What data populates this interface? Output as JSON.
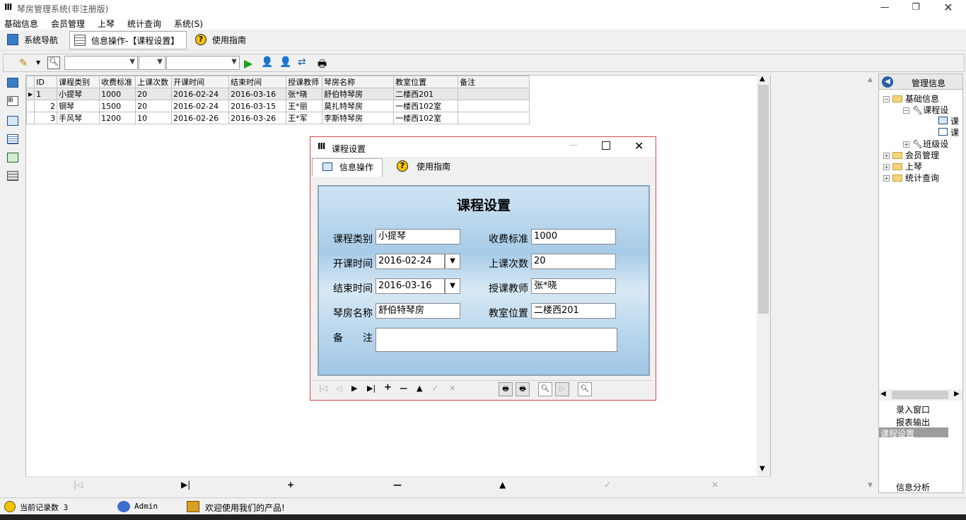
{
  "app": {
    "title": "琴房管理系统(非注册版)"
  },
  "menu": [
    "基础信息",
    "会员管理",
    "上琴",
    "统计查询",
    "系统(S)"
  ],
  "nav_tabs": [
    "系统导航",
    "信息操作-【课程设置】",
    "使用指南"
  ],
  "grid": {
    "columns": [
      "ID",
      "课程类别",
      "收费标准",
      "上课次数",
      "开课时间",
      "结束时间",
      "授课教师",
      "琴房名称",
      "教室位置",
      "备注"
    ],
    "rows": [
      [
        "1",
        "小提琴",
        "1000",
        "20",
        "2016-02-24",
        "2016-03-16",
        "张*晓",
        "舒伯特琴房",
        "二楼西201",
        ""
      ],
      [
        "2",
        "钢琴",
        "1500",
        "20",
        "2016-02-24",
        "2016-03-15",
        "王*丽",
        "莫扎特琴房",
        "一楼西102室",
        ""
      ],
      [
        "3",
        "手风琴",
        "1200",
        "10",
        "2016-02-26",
        "2016-03-26",
        "王*军",
        "李斯特琴房",
        "一楼西102室",
        ""
      ]
    ]
  },
  "right_panel": {
    "header": "管理信息",
    "tree": {
      "root": "基础信息",
      "course": "课程设",
      "leaf1": "课",
      "leaf2": "课",
      "class_setting": "班级设",
      "member": "会员管理",
      "piano": "上琴",
      "stats": "统计查询"
    },
    "list": [
      "录入窗口",
      "报表输出",
      "课程设置"
    ],
    "footer": "信息分析"
  },
  "statusbar": {
    "record_count": "当前记录数 3",
    "user": "Admin",
    "welcome": "欢迎使用我们的产品!"
  },
  "dialog": {
    "title": "课程设置",
    "tabs": [
      "信息操作",
      "使用指南"
    ],
    "heading": "课程设置",
    "fields": {
      "category_label": "课程类别",
      "category": "小提琴",
      "fee_label": "收费标准",
      "fee": "1000",
      "start_label": "开课时间",
      "start": "2016-02-24",
      "count_label": "上课次数",
      "count": "20",
      "end_label": "结束时间",
      "end": "2016-03-16",
      "teacher_label": "授课教师",
      "teacher": "张*晓",
      "room_label": "琴房名称",
      "room": "舒伯特琴房",
      "location_label": "教室位置",
      "location": "二楼西201",
      "note_label": "备　　注",
      "note": ""
    }
  }
}
